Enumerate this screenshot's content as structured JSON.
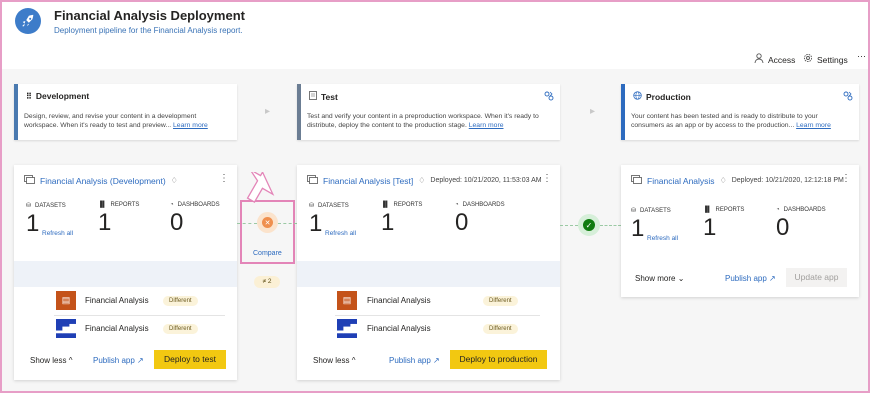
{
  "header": {
    "title": "Financial Analysis Deployment",
    "subtitle": "Deployment pipeline for the Financial Analysis report.",
    "access_label": "Access",
    "settings_label": "Settings",
    "more_label": "···"
  },
  "stages": [
    {
      "name": "Development",
      "description": "Design, review, and revise your content in a development workspace. When it's ready to test and preview...",
      "learn_more": "Learn more",
      "accent": "#4a7ab0"
    },
    {
      "name": "Test",
      "description": "Test and verify your content in a preproduction workspace. When it's ready to distribute, deploy the content to the production stage.",
      "learn_more": "Learn more",
      "accent": "#6b7d93"
    },
    {
      "name": "Production",
      "description": "Your content has been tested and is ready to distribute to your consumers as an app or by access to the production...",
      "learn_more": "Learn more",
      "accent": "#2d6bbf"
    }
  ],
  "cards": [
    {
      "workspace": "Financial Analysis (Development)",
      "deployed": "",
      "datasets_label": "DATASETS",
      "datasets": "1",
      "refresh_label": "Refresh all",
      "reports_label": "REPORTS",
      "reports": "1",
      "dashboards_label": "DASHBOARDS",
      "dashboards": "0",
      "items": [
        {
          "name": "Financial Analysis",
          "status": "Different"
        },
        {
          "name": "Financial Analysis",
          "status": "Different"
        }
      ],
      "toggle_label": "Show less",
      "publish_label": "Publish app ↗",
      "action_label": "Deploy to test"
    },
    {
      "workspace": "Financial Analysis [Test]",
      "deployed": "Deployed: 10/21/2020, 11:53:03 AM",
      "datasets_label": "DATASETS",
      "datasets": "1",
      "refresh_label": "Refresh all",
      "reports_label": "REPORTS",
      "reports": "1",
      "dashboards_label": "DASHBOARDS",
      "dashboards": "0",
      "items": [
        {
          "name": "Financial Analysis",
          "status": "Different"
        },
        {
          "name": "Financial Analysis",
          "status": "Different"
        }
      ],
      "toggle_label": "Show less",
      "publish_label": "Publish app ↗",
      "action_label": "Deploy to production"
    },
    {
      "workspace": "Financial Analysis",
      "deployed": "Deployed: 10/21/2020, 12:12:18 PM",
      "datasets_label": "DATASETS",
      "datasets": "1",
      "refresh_label": "Refresh all",
      "reports_label": "REPORTS",
      "reports": "1",
      "dashboards_label": "DASHBOARDS",
      "dashboards": "0",
      "toggle_label": "Show more",
      "publish_label": "Publish app ↗",
      "action_label": "Update app"
    }
  ],
  "compare": {
    "label": "Compare",
    "diff_count": "≠ 2"
  },
  "colors": {
    "accent": "#2d6bbf",
    "deploy_button": "#f2c811",
    "dataset_tile": "#c4531a",
    "report_tile": "#1f3fb5",
    "compare_highlight": "#e385b8",
    "success": "#107c10"
  }
}
